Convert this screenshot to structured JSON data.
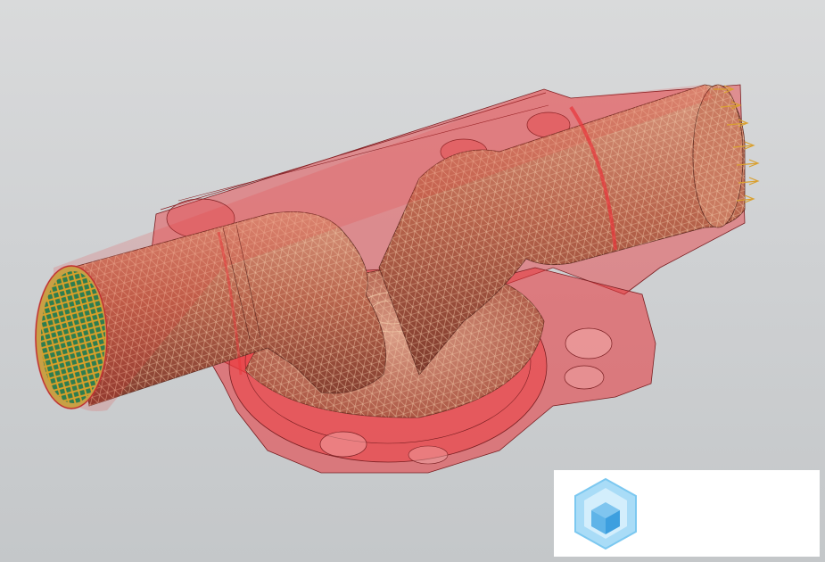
{
  "viewport": {
    "background_top": "#d9dadb",
    "background_bottom": "#c4c7c9"
  },
  "model": {
    "housing_color": "#e8353a",
    "pipe_color": "#b8644c",
    "mesh_color": "#f2c8a8",
    "face_mesh_colors": [
      "#d8a02a",
      "#2e7d4f"
    ],
    "load_arrow_color": "#d9a030"
  },
  "logo": {
    "icon": "cube-logo-icon",
    "text": ""
  }
}
